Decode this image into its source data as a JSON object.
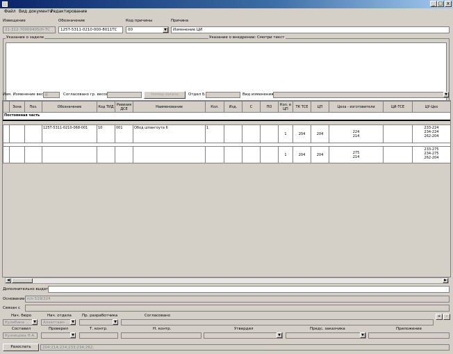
{
  "window": {
    "min": "_",
    "max": "□",
    "close": "x"
  },
  "menu": [
    "Файл",
    "Вид документа",
    "Редактирование"
  ],
  "header": {
    "notice_label": "Извещение",
    "notice_value": "21-312-70000405(Н-ТС",
    "designation_label": "Обозначение",
    "designation_value": "125Т-5311-0210-000-8011ТС",
    "reason_code_label": "Код причины",
    "reason_code_value": "00",
    "reason_label": "Причина",
    "reason_value": "Изменение ЦИ"
  },
  "reserve_label": "Указание о заделе",
  "implementation_label": "Указание о внедрении: Смотри текст",
  "weight_row": {
    "weight_change_label": "Изм. Изменение веса",
    "weight_change_value": "0",
    "agreed_label": "Согласовано гр. весов",
    "order_button": "Номер заказа",
    "dept_label": "Отдел Б",
    "change_type_label": "Вид изменения"
  },
  "table": {
    "columns": [
      "",
      "Зона",
      "Поз.",
      "Обозначение",
      "Код ТИД",
      "Ревизия ДСЕ",
      "Наименование",
      "Кол.",
      "Изд.",
      "С",
      "ПО",
      "Кол. в ЦП",
      "ТК ТСЕ",
      "ЦП",
      "Цеха - изготовители",
      "ЦИ-ТСЕ",
      "ЦУ-Цех"
    ],
    "section": "Постоянная часть",
    "rows": [
      [
        "",
        "",
        "",
        "125Т-5311-0210-068-001",
        "10",
        "001",
        "Обод шпангоута 6",
        "1",
        "",
        "",
        "",
        "1",
        "204",
        "204",
        "224\n214",
        "",
        "233-224\n234-224\n262-204"
      ],
      [
        "",
        "",
        "",
        "",
        "",
        "",
        "",
        "",
        "",
        "",
        "",
        "1",
        "204",
        "204",
        "275\n214",
        "",
        "233-275\n234-275\n262-204"
      ]
    ]
  },
  "extra_label": "Дополнительно выдать",
  "basis_label": "Основание",
  "basis_value": "п/п 519/224",
  "related_label": "Связан с",
  "approvals": {
    "bureau_head_label": "Нач. бюро",
    "bureau_head_value": "Кулебина ...",
    "dept_head_label": "Нач. отдела",
    "dept_head_value": "Алхаттаин ...",
    "developer_label": "Пр. разработчика",
    "agreed_label": "Согласовано",
    "add_btn": "+",
    "remove_btn": "-",
    "author_label": "Составил",
    "author_value": "Кузнецова Н.А.",
    "checked_label": "Проверил",
    "tcontrol_label": "Т. контр.",
    "ncontrol_label": "Н. контр.",
    "approved_label": "Утвердил",
    "customer_label": "Предс. заказчика",
    "attachment_label": "Приложение"
  },
  "send_button": "Разослать",
  "send_value": "204;214;224;233;234;262;"
}
